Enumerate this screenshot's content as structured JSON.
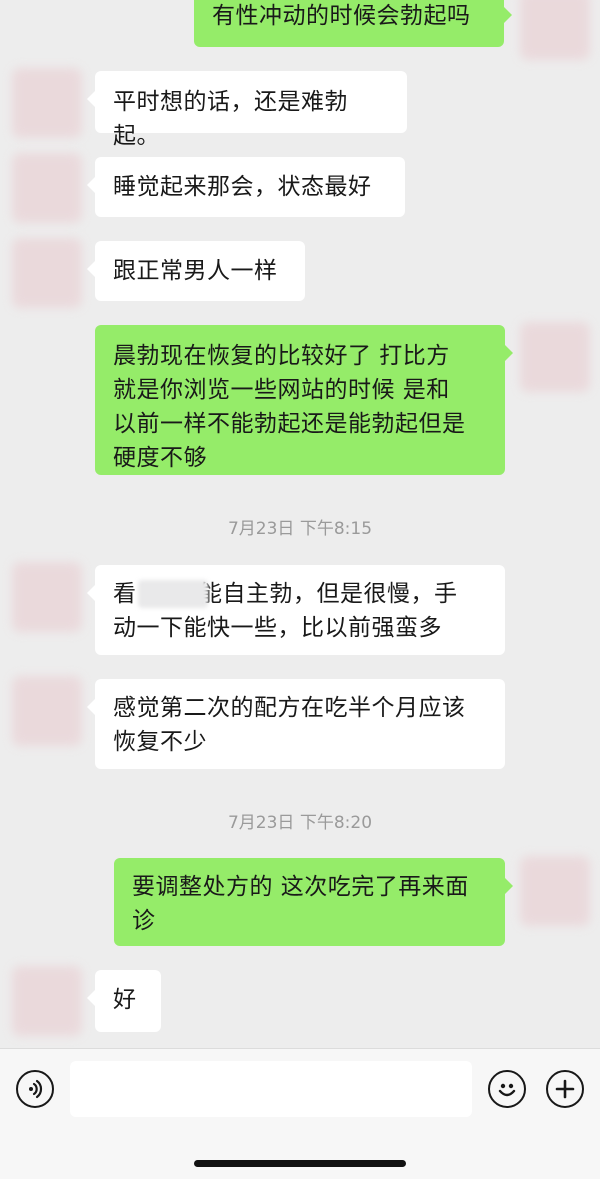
{
  "messages": [
    {
      "side": "out",
      "text": "有性冲动的时候会勃起吗"
    },
    {
      "side": "in",
      "text": "平时想的话，还是难勃起。"
    },
    {
      "side": "in",
      "text": "睡觉起来那会，状态最好"
    },
    {
      "side": "in",
      "text": "跟正常男人一样"
    },
    {
      "side": "out",
      "text": "晨勃现在恢复的比较好了 打比方\n就是你浏览一些网站的时候 是和\n以前一样不能勃起还是能勃起但是\n硬度不够"
    },
    {
      "side": "in",
      "text": "看        能自主勃，但是很慢，手\n动一下能快一些，比以前强蛮多"
    },
    {
      "side": "in",
      "text": "感觉第二次的配方在吃半个月应该\n恢复不少"
    },
    {
      "side": "out",
      "text": "要调整处方的 这次吃完了再来面\n诊"
    },
    {
      "side": "in",
      "text": "好"
    }
  ],
  "timestamps": [
    "7月23日 下午8:15",
    "7月23日 下午8:20"
  ],
  "input": {
    "placeholder": "",
    "value": ""
  },
  "icons": {
    "voice": "voice-icon",
    "emoji": "emoji-icon",
    "plus": "plus-icon"
  },
  "colors": {
    "background": "#ededed",
    "outgoing_bubble": "#95ec69",
    "incoming_bubble": "#ffffff",
    "timestamp": "#9a9a9a"
  }
}
